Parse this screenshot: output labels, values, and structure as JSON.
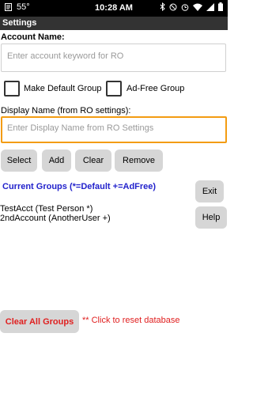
{
  "status_bar": {
    "temperature": "55°",
    "time": "10:28 AM",
    "icons": [
      "notification-icon",
      "bluetooth-icon",
      "mute-icon",
      "alarm-icon",
      "wifi-icon",
      "signal-icon",
      "battery-icon"
    ]
  },
  "title_bar": {
    "title": "Settings"
  },
  "account": {
    "label": "Account Name:",
    "placeholder": "Enter account keyword for RO"
  },
  "options": {
    "make_default_label": "Make Default Group",
    "ad_free_label": "Ad-Free Group"
  },
  "display_name": {
    "label": "Display Name (from RO settings):",
    "placeholder": "Enter Display Name from RO Settings"
  },
  "actions": {
    "select": "Select",
    "add": "Add",
    "clear": "Clear",
    "remove": "Remove"
  },
  "groups": {
    "title": "Current Groups (*=Default +=AdFree)",
    "items": [
      "TestAcct (Test Person *)",
      "2ndAccount (AnotherUser +)"
    ]
  },
  "side_buttons": {
    "exit": "Exit",
    "help": "Help"
  },
  "footer": {
    "clear_all": "Clear All Groups",
    "note": "** Click to reset database"
  },
  "colors": {
    "accent_orange": "#f39c12",
    "groups_blue": "#2222cc",
    "danger_red": "#e02020"
  }
}
